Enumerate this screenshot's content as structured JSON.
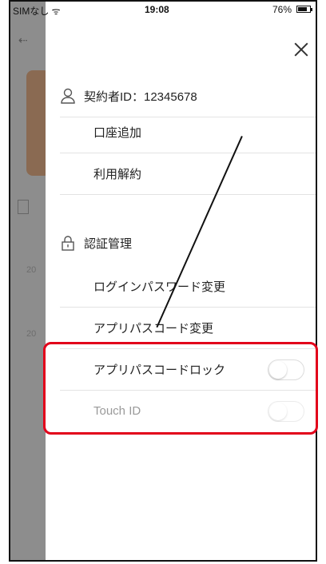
{
  "status": {
    "carrier": "SIMなし ᯤ",
    "time": "19:08",
    "battery": "76%"
  },
  "menu": {
    "account_id": "契約者ID：12345678",
    "items": [
      {
        "label": "口座追加"
      },
      {
        "label": "利用解約"
      }
    ],
    "auth_section": "認証管理",
    "auth_items": [
      {
        "label": "ログインパスワード変更"
      },
      {
        "label": "アプリパスコード変更"
      }
    ],
    "toggles": [
      {
        "label": "アプリパスコードロック",
        "on": false,
        "enabled": true
      },
      {
        "label": "Touch ID",
        "on": false,
        "enabled": false
      }
    ]
  },
  "background": {
    "numbers": [
      "20",
      "20"
    ]
  },
  "colors": {
    "highlight": "#e2001a",
    "dim": "#8d8d8d"
  }
}
